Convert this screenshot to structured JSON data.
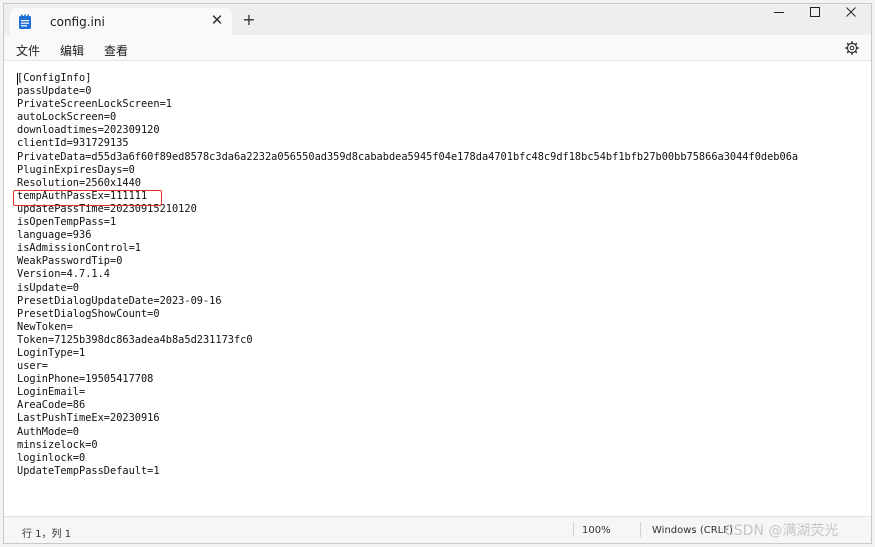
{
  "window": {
    "tab_title": "config.ini",
    "tab_close_glyph": "✕",
    "new_tab_glyph": "+",
    "minimize_glyph": "—",
    "maximize_glyph": "☐",
    "close_glyph": "✕"
  },
  "menu": {
    "file": "文件",
    "edit": "编辑",
    "view": "查看"
  },
  "editor": {
    "highlighted_line": "tempAuthPassEx=111111",
    "lines": [
      "[ConfigInfo]",
      "passUpdate=0",
      "PrivateScreenLockScreen=1",
      "autoLockScreen=0",
      "downloadtimes=202309120",
      "clientId=931729135",
      "PrivateData=d55d3a6f60f89ed8578c3da6a2232a056550ad359d8cababdea5945f04e178da4701bfc48c9df18bc54bf1bfb27b00bb75866a3044f0deb06a",
      "PluginExpiresDays=0",
      "Resolution=2560x1440",
      "tempAuthPassEx=111111",
      "updatePassTime=20230915210120",
      "isOpenTempPass=1",
      "language=936",
      "isAdmissionControl=1",
      "WeakPasswordTip=0",
      "Version=4.7.1.4",
      "isUpdate=0",
      "PresetDialogUpdateDate=2023-09-16",
      "PresetDialogShowCount=0",
      "NewToken=",
      "Token=7125b398dc863adea4b8a5d231173fc0",
      "LoginType=1",
      "user=",
      "LoginPhone=19505417708",
      "LoginEmail=",
      "AreaCode=86",
      "LastPushTimeEx=20230916",
      "AuthMode=0",
      "minsizelock=0",
      "loginlock=0",
      "UpdateTempPassDefault=1"
    ]
  },
  "status": {
    "position": "行 1，列 1",
    "zoom": "100%",
    "line_endings": "Windows (CRLF)",
    "watermark": "CSDN @满湖荧光"
  },
  "colors": {
    "highlight_border": "#e0332b",
    "notepad_icon": "#1e6fd9"
  },
  "icons": {
    "tab": "notepad-icon",
    "settings": "gear-icon"
  }
}
